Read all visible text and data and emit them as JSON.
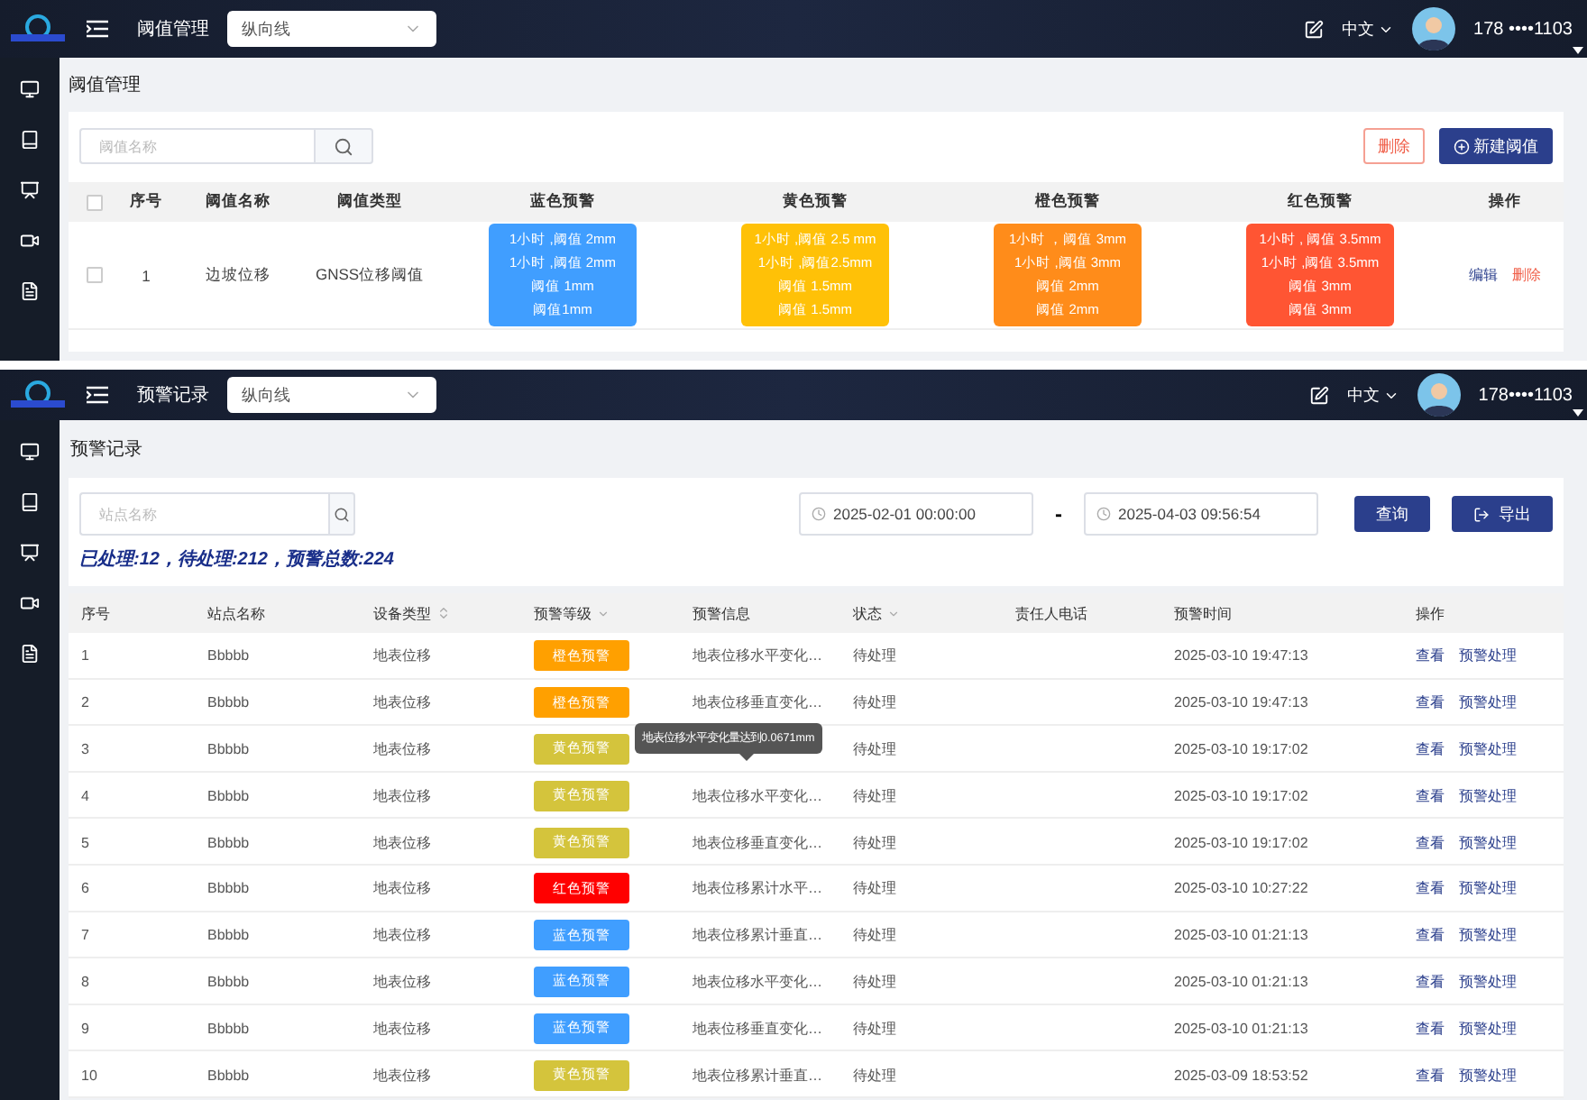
{
  "threshold_screen": {
    "header": {
      "page_name": "阈值管理",
      "line_select": "纵向线",
      "language": "中文",
      "phone": "178 ••••1103"
    },
    "title": "阈值管理",
    "search": {
      "placeholder": "阈值名称"
    },
    "buttons": [
      {
        "label": "删除",
        "kind": "danger"
      },
      {
        "label": "新建阈值",
        "kind": "primary"
      }
    ],
    "table": {
      "select_all_checked": false,
      "columns": [
        "序号",
        "阈值名称",
        "阈值类型",
        "蓝色预警",
        "黄色预警",
        "橙色预警",
        "红色预警",
        "操作"
      ],
      "rows": [
        {
          "checked": false,
          "index": "1",
          "name": "边坡位移",
          "type": "GNSS位移阈值",
          "levels": [
            {
              "color": "#409eff",
              "lines": [
                "1小时 ,阈值 2mm",
                "1小时 ,阈值 2mm",
                "阈值 1mm",
                "阈值1mm"
              ]
            },
            {
              "color": "#ffc107",
              "lines": [
                "1小时 ,阈值 2.5 mm",
                "1小时 ,阈值2.5mm",
                "阈值 1.5mm",
                "阈值 1.5mm"
              ]
            },
            {
              "color": "#ff8c1a",
              "lines": [
                "1小时 ，阈值 3mm",
                "1小时 ,阈值 3mm",
                "阈值 2mm",
                "阈值 2mm"
              ]
            },
            {
              "color": "#ff5533",
              "lines": [
                "1小时 , 阈值 3.5mm",
                "1小时 ,阈值 3.5mm",
                "阈值 3mm",
                "阈值 3mm"
              ]
            }
          ],
          "actions": [
            {
              "label": "编辑",
              "kind": "edit"
            },
            {
              "label": "删除",
              "kind": "delete"
            }
          ]
        }
      ]
    }
  },
  "records_screen": {
    "header": {
      "page_name": "预警记录",
      "line_select": "纵向线",
      "language": "中文",
      "phone": "178••••1103"
    },
    "title": "预警记录",
    "search": {
      "placeholder": "站点名称"
    },
    "date_range": {
      "start": "2025-02-01 00:00:00",
      "separator": "-",
      "end": "2025-04-03 09:56:54"
    },
    "buttons": [
      {
        "label": "查询",
        "kind": "query"
      },
      {
        "label": "导出",
        "kind": "export"
      }
    ],
    "summary": "已处理:12，待处理:212，预警总数:224",
    "table": {
      "columns": [
        {
          "label": "序号",
          "kind": "plain"
        },
        {
          "label": "站点名称",
          "kind": "plain"
        },
        {
          "label": "设备类型",
          "kind": "sort"
        },
        {
          "label": "预警等级",
          "kind": "filter"
        },
        {
          "label": "预警信息",
          "kind": "plain"
        },
        {
          "label": "状态",
          "kind": "filter"
        },
        {
          "label": "责任人电话",
          "kind": "plain"
        },
        {
          "label": "预警时间",
          "kind": "plain"
        },
        {
          "label": "操作",
          "kind": "plain"
        }
      ],
      "rows": [
        {
          "index": "1",
          "station": "Bbbbb",
          "device": "地表位移",
          "level": {
            "label": "橙色预警",
            "color": "#ffa000"
          },
          "info": "地表位移水平变化…",
          "status": "待处理",
          "time": "2025-03-10 19:47:13",
          "actions": [
            "查看",
            "预警处理"
          ]
        },
        {
          "index": "2",
          "station": "Bbbbb",
          "device": "地表位移",
          "level": {
            "label": "橙色预警",
            "color": "#ffa000"
          },
          "info": "地表位移垂直变化…",
          "status": "待处理",
          "time": "2025-03-10 19:47:13",
          "actions": [
            "查看",
            "预警处理"
          ]
        },
        {
          "index": "3",
          "station": "Bbbbb",
          "device": "地表位移",
          "level": {
            "label": "黄色预警",
            "color": "#d4c43c"
          },
          "tooltip": "地表位移水平变化量达到0.0671mm",
          "status": "待处理",
          "time": "2025-03-10 19:17:02",
          "actions": [
            "查看",
            "预警处理"
          ]
        },
        {
          "index": "4",
          "station": "Bbbbb",
          "device": "地表位移",
          "level": {
            "label": "黄色预警",
            "color": "#d4c43c"
          },
          "info": "地表位移水平变化…",
          "status": "待处理",
          "time": "2025-03-10 19:17:02",
          "actions": [
            "查看",
            "预警处理"
          ]
        },
        {
          "index": "5",
          "station": "Bbbbb",
          "device": "地表位移",
          "level": {
            "label": "黄色预警",
            "color": "#d4c43c"
          },
          "info": "地表位移垂直变化…",
          "status": "待处理",
          "time": "2025-03-10 19:17:02",
          "actions": [
            "查看",
            "预警处理"
          ]
        },
        {
          "index": "6",
          "station": "Bbbbb",
          "device": "地表位移",
          "level": {
            "label": "红色预警",
            "color": "#ff0000"
          },
          "info": "地表位移累计水平…",
          "status": "待处理",
          "time": "2025-03-10 10:27:22",
          "actions": [
            "查看",
            "预警处理"
          ]
        },
        {
          "index": "7",
          "station": "Bbbbb",
          "device": "地表位移",
          "level": {
            "label": "蓝色预警",
            "color": "#409eff"
          },
          "info": "地表位移累计垂直…",
          "status": "待处理",
          "time": "2025-03-10 01:21:13",
          "actions": [
            "查看",
            "预警处理"
          ]
        },
        {
          "index": "8",
          "station": "Bbbbb",
          "device": "地表位移",
          "level": {
            "label": "蓝色预警",
            "color": "#409eff"
          },
          "info": "地表位移水平变化…",
          "status": "待处理",
          "time": "2025-03-10 01:21:13",
          "actions": [
            "查看",
            "预警处理"
          ]
        },
        {
          "index": "9",
          "station": "Bbbbb",
          "device": "地表位移",
          "level": {
            "label": "蓝色预警",
            "color": "#409eff"
          },
          "info": "地表位移垂直变化…",
          "status": "待处理",
          "time": "2025-03-10 01:21:13",
          "actions": [
            "查看",
            "预警处理"
          ]
        },
        {
          "index": "10",
          "station": "Bbbbb",
          "device": "地表位移",
          "level": {
            "label": "黄色预警",
            "color": "#d4c43c"
          },
          "info": "地表位移累计垂直…",
          "status": "待处理",
          "time": "2025-03-09 18:53:52",
          "actions": [
            "查看",
            "预警处理"
          ]
        }
      ]
    }
  }
}
